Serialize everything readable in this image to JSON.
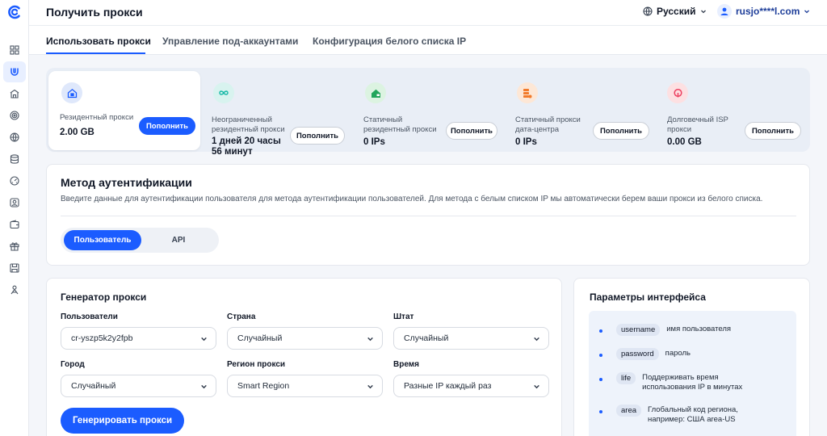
{
  "header": {
    "title": "Получить прокси",
    "language": "Русский",
    "user_email": "rusjo****l.com"
  },
  "tabs": [
    "Использовать прокси",
    "Управление под-аккаунтами",
    "Конфигурация белого списка IP"
  ],
  "sidebar": {
    "icons": [
      "dashboard-icon",
      "magnet-icon",
      "building-icon",
      "target-icon",
      "globe-icon",
      "database-icon",
      "gauge-icon",
      "user-card-icon",
      "wallet-icon",
      "gift-icon",
      "save-icon",
      "referral-icon"
    ],
    "active_index": 1
  },
  "products": [
    {
      "name": "Резидентный прокси",
      "value": "2.00 GB",
      "button": "Пополнить",
      "icon": "home-lock-icon"
    },
    {
      "name": "Неограниченный резидентный прокси",
      "value": "1 дней 20 часы 56 минут",
      "button": "Пополнить",
      "icon": "infinity-icon"
    },
    {
      "name": "Статичный резидентный прокси",
      "value": "0 IPs",
      "button": "Пополнить",
      "icon": "static-home-icon"
    },
    {
      "name": "Статичный прокси дата-центра",
      "value": "0 IPs",
      "button": "Пополнить",
      "icon": "server-icon"
    },
    {
      "name": "Долговечный ISP прокси",
      "value": "0.00 GB",
      "button": "Пополнить",
      "icon": "isp-icon"
    }
  ],
  "auth": {
    "title": "Метод аутентификации",
    "description": "Введите данные для аутентификации пользователя для метода аутентификации пользователей. Для метода с белым списком IP мы автоматически берем ваши прокси из белого списка.",
    "options": [
      "Пользователь",
      "API"
    ],
    "selected": "Пользователь"
  },
  "generator": {
    "title": "Генератор прокси",
    "fields": [
      {
        "label": "Пользователи",
        "value": "cr-yszp5k2y2fpb"
      },
      {
        "label": "Страна",
        "value": "Случайный"
      },
      {
        "label": "Штат",
        "value": "Случайный"
      },
      {
        "label": "Город",
        "value": "Случайный"
      },
      {
        "label": "Регион прокси",
        "value": "Smart Region"
      },
      {
        "label": "Время",
        "value": "Разные IP каждый раз"
      }
    ],
    "button": "Генерировать прокси"
  },
  "params": {
    "title": "Параметры интерфейса",
    "items": [
      {
        "key": "username",
        "desc": "имя пользователя"
      },
      {
        "key": "password",
        "desc": "пароль"
      },
      {
        "key": "life",
        "desc": "Поддерживать время использования IP в минутах"
      },
      {
        "key": "area",
        "desc": "Глобальный код региона, например: США area-US"
      }
    ]
  },
  "colors": {
    "accent": "#1b5cff",
    "background": "#f4f6fa"
  }
}
